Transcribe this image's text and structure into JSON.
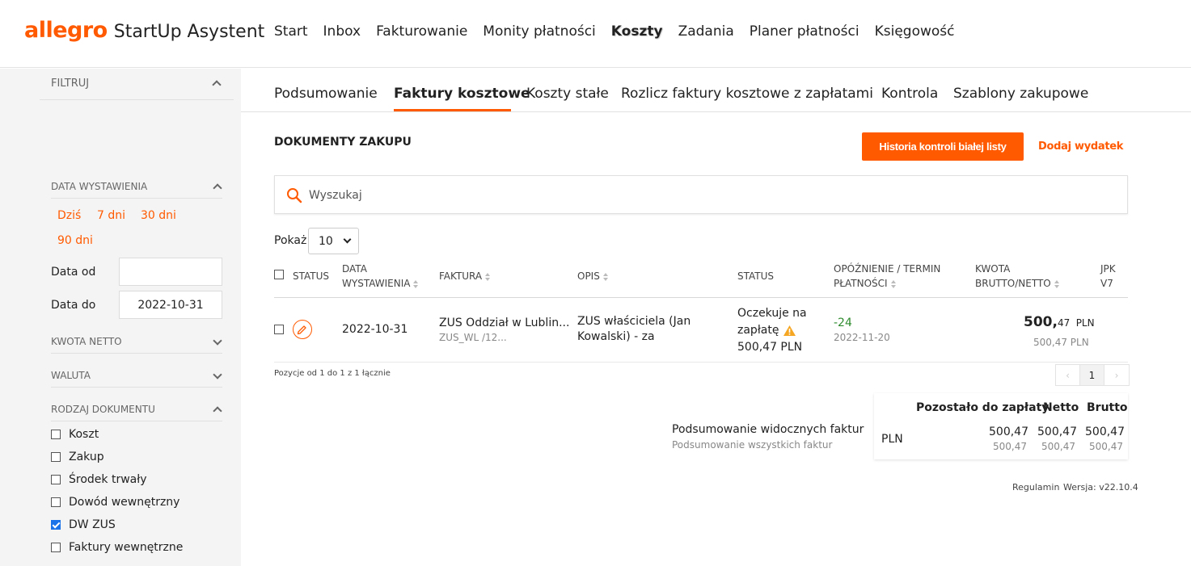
{
  "app": {
    "brand": "allegro",
    "name": "StartUp Asystent"
  },
  "topnav": [
    "Start",
    "Inbox",
    "Fakturowanie",
    "Monity płatności",
    "Koszty",
    "Zadania",
    "Planer płatności",
    "Księgowość"
  ],
  "topnav_active": "Koszty",
  "subnav": [
    "Podsumowanie",
    "Faktury kosztowe",
    "Koszty stałe",
    "Rozlicz faktury kosztowe z zapłatami",
    "Kontrola",
    "Szablony zakupowe"
  ],
  "subnav_active": "Faktury kosztowe",
  "sidebar": {
    "filter_label": "FILTRUJ",
    "date_section": "DATA WYSTAWIENIA",
    "quick_ranges": [
      "Dziś",
      "7 dni",
      "30 dni",
      "90 dni"
    ],
    "date_from_label": "Data od",
    "date_from_value": "",
    "date_to_label": "Data do",
    "date_to_value": "2022-10-31",
    "amount_section": "KWOTA NETTO",
    "currency_section": "WALUTA",
    "doctype_section": "RODZAJ DOKUMENTU",
    "doctypes": [
      {
        "label": "Koszt",
        "checked": false
      },
      {
        "label": "Zakup",
        "checked": false
      },
      {
        "label": "Środek trwały",
        "checked": false
      },
      {
        "label": "Dowód wewnętrzny",
        "checked": false
      },
      {
        "label": "DW ZUS",
        "checked": true
      },
      {
        "label": "Faktury wewnętrzne",
        "checked": false
      }
    ]
  },
  "main": {
    "title": "DOKUMENTY ZAKUPU",
    "btn_history": "Historia kontroli białej listy",
    "btn_add": "Dodaj wydatek",
    "search_placeholder": "Wyszukaj",
    "show_label": "Pokaż",
    "show_value": "10"
  },
  "table": {
    "headers": {
      "status": "STATUS",
      "date_1": "DATA",
      "date_2": "WYSTAWIENIA",
      "invoice": "FAKTURA",
      "desc": "OPIS",
      "status2": "STATUS",
      "delay_1": "OPÓŹNIENIE / TERMIN",
      "delay_2": "PŁATNOŚCI",
      "amount_1": "KWOTA",
      "amount_2": "BRUTTO/NETTO",
      "jpk_1": "JPK",
      "jpk_2": "V7"
    },
    "row": {
      "date": "2022-10-31",
      "invoice": "ZUS Oddział w Lublin...",
      "invoice_sub": "ZUS_WL /12...",
      "desc_1": "ZUS właściciela (Jan",
      "desc_2": "Kowalski) - za",
      "status_1": "Oczekuje na",
      "status_2": "zapłatę",
      "status_3": "500,47 PLN",
      "delay": "-24",
      "due": "2022-11-20",
      "gross_int": "500,",
      "gross_dec": "47",
      "currency": "PLN",
      "net": "500,47 PLN"
    },
    "footer_count": "Pozycje od 1 do 1 z 1 łącznie",
    "pages": [
      "‹",
      "1",
      "›"
    ]
  },
  "summary": {
    "visible_label": "Podsumowanie widocznych faktur",
    "all_label": "Podsumowanie wszystkich faktur",
    "col_remaining": "Pozostało do zapłaty",
    "col_net": "Netto",
    "col_gross": "Brutto",
    "currency": "PLN",
    "visible": [
      "500,47",
      "500,47",
      "500,47"
    ],
    "all": [
      "500,47",
      "500,47",
      "500,47"
    ]
  },
  "footer": {
    "terms": "Regulamin",
    "version": "Wersja: v22.10.4"
  },
  "colors": {
    "accent": "#ff5a00",
    "delay_green": "#2e8b2e",
    "warning": "#f5a623"
  }
}
